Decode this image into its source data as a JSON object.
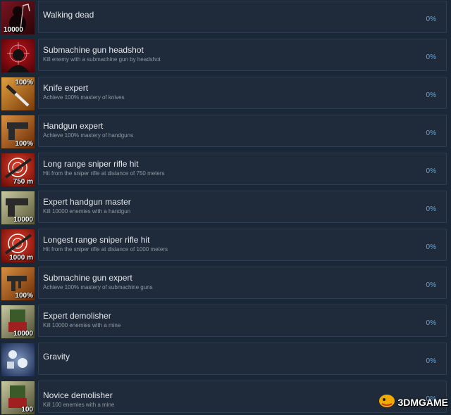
{
  "achievements": [
    {
      "title": "Walking dead",
      "desc": "",
      "pct": "0%",
      "badge": "10000",
      "icon": "zombie-reaper-icon"
    },
    {
      "title": "Submachine gun headshot",
      "desc": "Kill enemy with a submachine gun by headshot",
      "pct": "0%",
      "badge": "",
      "icon": "headshot-crosshair-icon"
    },
    {
      "title": "Knife expert",
      "desc": "Achieve 100% mastery of knives",
      "pct": "0%",
      "badge": "100%",
      "icon": "knife-icon"
    },
    {
      "title": "Handgun expert",
      "desc": "Achieve 100% mastery of handguns",
      "pct": "0%",
      "badge": "100%",
      "icon": "handgun-icon"
    },
    {
      "title": "Long range sniper rifle hit",
      "desc": "Hit from the sniper rifle at distance of 750 meters",
      "pct": "0%",
      "badge": "750 m",
      "icon": "sniper-target-icon"
    },
    {
      "title": "Expert handgun master",
      "desc": "Kill 10000 enemies with a handgun",
      "pct": "0%",
      "badge": "10000",
      "icon": "handgun-icon"
    },
    {
      "title": "Longest range sniper rifle hit",
      "desc": "Hit from the sniper rifle at distance of 1000 meters",
      "pct": "0%",
      "badge": "1000 m",
      "icon": "sniper-target-icon"
    },
    {
      "title": "Submachine gun expert",
      "desc": "Achieve 100% mastery of submachine guns",
      "pct": "0%",
      "badge": "100%",
      "icon": "submachine-gun-icon"
    },
    {
      "title": "Expert demolisher",
      "desc": "Kill 10000 enemies with a mine",
      "pct": "0%",
      "badge": "10000",
      "icon": "mine-icon"
    },
    {
      "title": "Gravity",
      "desc": "",
      "pct": "0%",
      "badge": "",
      "icon": "falling-bodies-icon"
    },
    {
      "title": "Novice demolisher",
      "desc": "Kill 100 enemies with a mine",
      "pct": "0%",
      "badge": "100",
      "icon": "mine-icon"
    }
  ],
  "watermark": {
    "text": "3DMGAME",
    "icon": "dragon-logo-icon"
  },
  "colors": {
    "background": "#1b2838",
    "panel": "#1f2b3b",
    "percent": "#63a3d6",
    "title": "#e4e7ea",
    "description": "#8f98a0"
  }
}
